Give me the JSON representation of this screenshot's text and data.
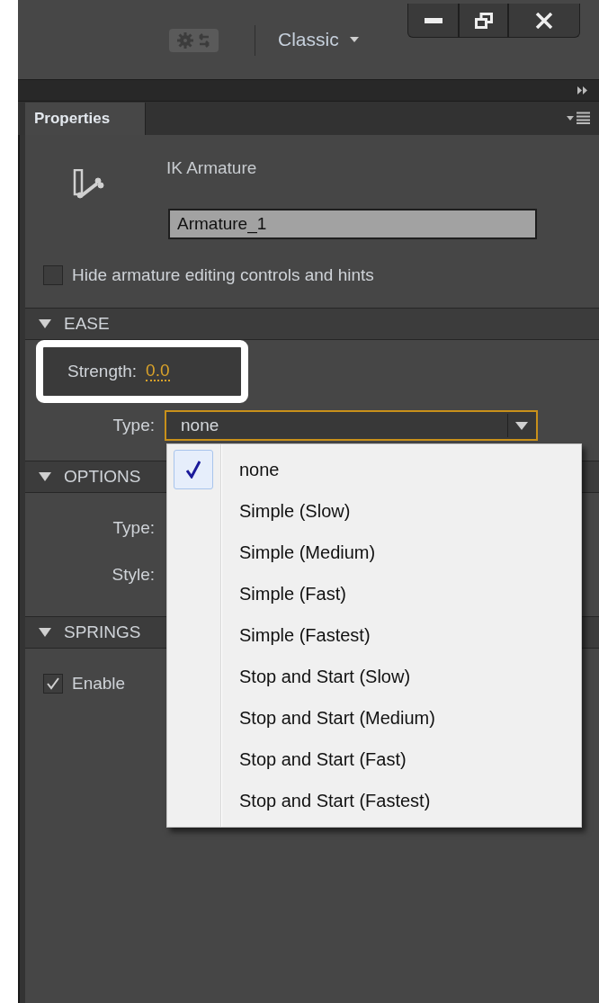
{
  "toolbar": {
    "workspace": "Classic"
  },
  "panel_tab": {
    "label": "Properties",
    "selected": true
  },
  "instance": {
    "type_label": "IK Armature",
    "name_value": "Armature_1"
  },
  "hide_controls": {
    "label": "Hide armature editing controls and hints",
    "checked": false
  },
  "ease": {
    "title": "EASE",
    "expanded": true,
    "strength_label": "Strength:",
    "strength_value": "0.0",
    "type_label": "Type:",
    "type_value": "none"
  },
  "options": {
    "title": "OPTIONS",
    "expanded": true,
    "labels": [
      "Type:",
      "Style:"
    ]
  },
  "springs": {
    "title": "SPRINGS",
    "expanded": true,
    "enable": {
      "label": "Enable",
      "checked": true
    }
  },
  "menu": {
    "items": [
      {
        "label": "none",
        "selected": true
      },
      {
        "label": "Simple (Slow)",
        "selected": false
      },
      {
        "label": "Simple (Medium)",
        "selected": false
      },
      {
        "label": "Simple (Fast)",
        "selected": false
      },
      {
        "label": "Simple (Fastest)",
        "selected": false
      },
      {
        "label": "Stop and Start (Slow)",
        "selected": false
      },
      {
        "label": "Stop and Start (Medium)",
        "selected": false
      },
      {
        "label": "Stop and Start (Fast)",
        "selected": false
      },
      {
        "label": "Stop and Start (Fastest)",
        "selected": false
      }
    ]
  }
}
